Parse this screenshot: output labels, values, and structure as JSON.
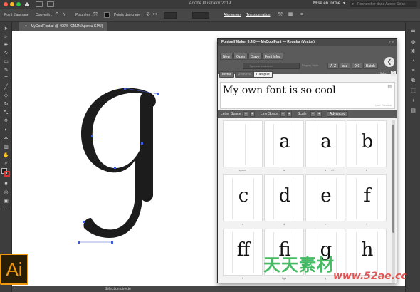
{
  "app": {
    "title": "Adobe Illustrator 2019",
    "workspace": "Mise en forme",
    "search_placeholder": "Rechercher dans Adobe Stock"
  },
  "control_bar": {
    "anchor_point_label": "Point d'ancrage",
    "convert_label": "Convertir :",
    "handles_label": "Poignées :",
    "anchor_points_label": "Points d'ancrage :",
    "align_label": "Alignement",
    "transform_label": "Transformation"
  },
  "document": {
    "tab_title": "MyCoolFont.ai @ 400% (CMJN/Aperçu GPU)",
    "glyph": "g",
    "status_text": "Sélection directe"
  },
  "panel": {
    "title": "Fontself Maker 3.4.0 — MyCoolFont — Regular (Vector)",
    "buttons": {
      "new": "New",
      "open": "Open",
      "save": "Save",
      "font_infos": "Font Infos"
    },
    "search_placeholder": "Type our character",
    "display_style_label": "Display Style:",
    "case_buttons": [
      "A-Z",
      "a-z",
      "0-9",
      "Batch"
    ],
    "tabs": {
      "install": "Install",
      "remove": "Remove",
      "catapult": "Catapult"
    },
    "help_label": "Help",
    "preview_text": "My own font is so cool",
    "live_preview_label": "Live Preview",
    "options": {
      "letter_space": "Letter Space :",
      "line_space": "Line Space :",
      "scale": "Scale :",
      "advanced": "Advanced"
    },
    "glyphs": [
      {
        "char": "",
        "label": "space"
      },
      {
        "char": "a",
        "label": "a"
      },
      {
        "char": "a",
        "label": "a",
        "count": "alt1"
      },
      {
        "char": "b",
        "label": "b"
      },
      {
        "char": "c",
        "label": "c"
      },
      {
        "char": "d",
        "label": "d"
      },
      {
        "char": "e",
        "label": "e"
      },
      {
        "char": "f",
        "label": "f"
      },
      {
        "char": "ﬀ",
        "label": "ff"
      },
      {
        "char": "ﬁ",
        "label": "figa"
      },
      {
        "char": "g",
        "label": "g"
      },
      {
        "char": "h",
        "label": "h"
      }
    ]
  },
  "watermark": {
    "line1": "天天素材",
    "line2": "www.52ae.cc"
  },
  "colors": {
    "accent": "#f29a10",
    "panel_bg": "#f2f2f2",
    "canvas_bg": "#ffffff",
    "selection": "#3f5bd6"
  }
}
